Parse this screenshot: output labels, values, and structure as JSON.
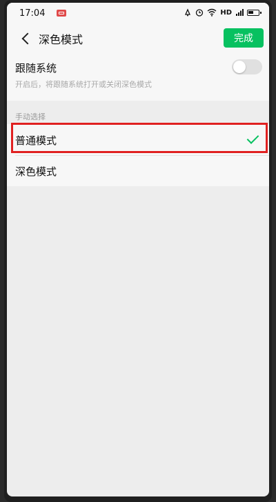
{
  "status_bar": {
    "time": "17:04",
    "network": "HD"
  },
  "nav": {
    "title": "深色模式",
    "done_label": "完成"
  },
  "follow_system": {
    "label": "跟随系统",
    "description": "开启后，将跟随系统打开或关闭深色模式",
    "enabled": false
  },
  "manual": {
    "header": "手动选择",
    "options": [
      {
        "label": "普通模式",
        "selected": true
      },
      {
        "label": "深色模式",
        "selected": false
      }
    ]
  },
  "colors": {
    "accent": "#07c160",
    "highlight": "#e02020",
    "background": "#ededed"
  },
  "icons": [
    "notification-icon",
    "alarm-icon",
    "clock-icon",
    "wifi-icon",
    "signal-icon",
    "battery-icon",
    "back-icon",
    "check-icon"
  ]
}
